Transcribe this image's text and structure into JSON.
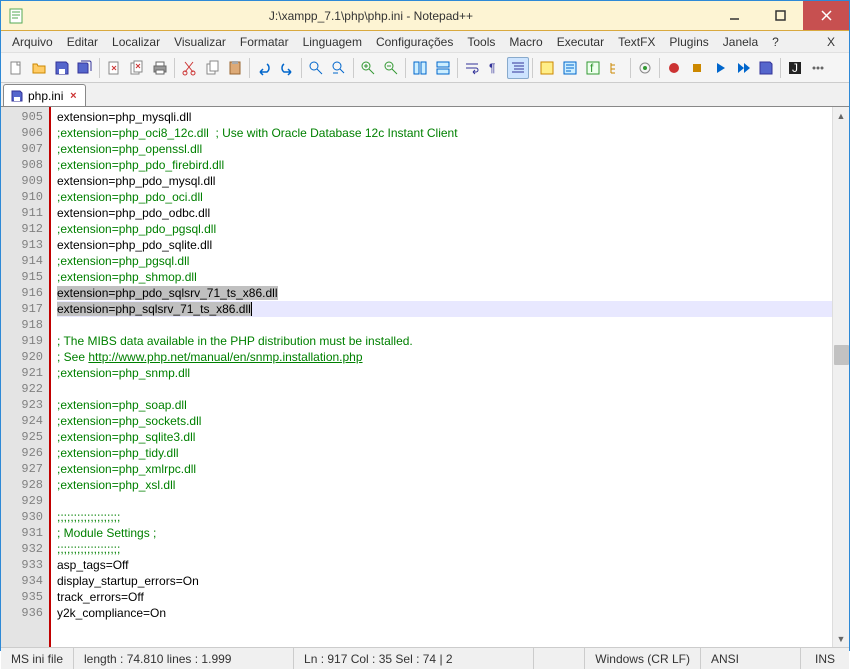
{
  "title": "J:\\xampp_7.1\\php\\php.ini - Notepad++",
  "menu": [
    "Arquivo",
    "Editar",
    "Localizar",
    "Visualizar",
    "Formatar",
    "Linguagem",
    "Configurações",
    "Tools",
    "Macro",
    "Executar",
    "TextFX",
    "Plugins",
    "Janela",
    "?"
  ],
  "tab": {
    "label": "php.ini"
  },
  "lines": [
    {
      "n": 905,
      "t": "extension=php_mysqli.dll",
      "c": "kw"
    },
    {
      "n": 906,
      "t": ";extension=php_oci8_12c.dll  ; Use with Oracle Database 12c Instant Client",
      "c": "cm"
    },
    {
      "n": 907,
      "t": ";extension=php_openssl.dll",
      "c": "cm"
    },
    {
      "n": 908,
      "t": ";extension=php_pdo_firebird.dll",
      "c": "cm"
    },
    {
      "n": 909,
      "t": "extension=php_pdo_mysql.dll",
      "c": "kw"
    },
    {
      "n": 910,
      "t": ";extension=php_pdo_oci.dll",
      "c": "cm"
    },
    {
      "n": 911,
      "t": "extension=php_pdo_odbc.dll",
      "c": "kw"
    },
    {
      "n": 912,
      "t": ";extension=php_pdo_pgsql.dll",
      "c": "cm"
    },
    {
      "n": 913,
      "t": "extension=php_pdo_sqlite.dll",
      "c": "kw"
    },
    {
      "n": 914,
      "t": ";extension=php_pgsql.dll",
      "c": "cm"
    },
    {
      "n": 915,
      "t": ";extension=php_shmop.dll",
      "c": "cm"
    },
    {
      "n": 916,
      "t": "extension=php_pdo_sqlsrv_71_ts_x86.dll",
      "c": "kw",
      "sel": true
    },
    {
      "n": 917,
      "t": "extension=php_sqlsrv_71_ts_x86.dll",
      "c": "kw",
      "hl": true,
      "sel": true,
      "caret": true
    },
    {
      "n": 918,
      "t": "",
      "c": "kw"
    },
    {
      "n": 919,
      "t": "; The MIBS data available in the PHP distribution must be installed.",
      "c": "cm"
    },
    {
      "n": 920,
      "pre": "; See ",
      "url": "http://www.php.net/manual/en/snmp.installation.php",
      "c": "cm"
    },
    {
      "n": 921,
      "t": ";extension=php_snmp.dll",
      "c": "cm"
    },
    {
      "n": 922,
      "t": "",
      "c": "kw"
    },
    {
      "n": 923,
      "t": ";extension=php_soap.dll",
      "c": "cm"
    },
    {
      "n": 924,
      "t": ";extension=php_sockets.dll",
      "c": "cm"
    },
    {
      "n": 925,
      "t": ";extension=php_sqlite3.dll",
      "c": "cm"
    },
    {
      "n": 926,
      "t": ";extension=php_tidy.dll",
      "c": "cm"
    },
    {
      "n": 927,
      "t": ";extension=php_xmlrpc.dll",
      "c": "cm"
    },
    {
      "n": 928,
      "t": ";extension=php_xsl.dll",
      "c": "cm"
    },
    {
      "n": 929,
      "t": "",
      "c": "kw"
    },
    {
      "n": 930,
      "t": ";;;;;;;;;;;;;;;;;;;",
      "c": "cm"
    },
    {
      "n": 931,
      "t": "; Module Settings ;",
      "c": "cm"
    },
    {
      "n": 932,
      "t": ";;;;;;;;;;;;;;;;;;;",
      "c": "cm"
    },
    {
      "n": 933,
      "t": "asp_tags=Off",
      "c": "kw"
    },
    {
      "n": 934,
      "t": "display_startup_errors=On",
      "c": "kw"
    },
    {
      "n": 935,
      "t": "track_errors=Off",
      "c": "kw"
    },
    {
      "n": 936,
      "t": "y2k_compliance=On",
      "c": "kw"
    }
  ],
  "status": {
    "lang": "MS ini file",
    "length": "length : 74.810    lines : 1.999",
    "pos": "Ln : 917    Col : 35    Sel : 74 | 2",
    "eol": "Windows (CR LF)",
    "enc": "ANSI",
    "mode": "INS"
  }
}
